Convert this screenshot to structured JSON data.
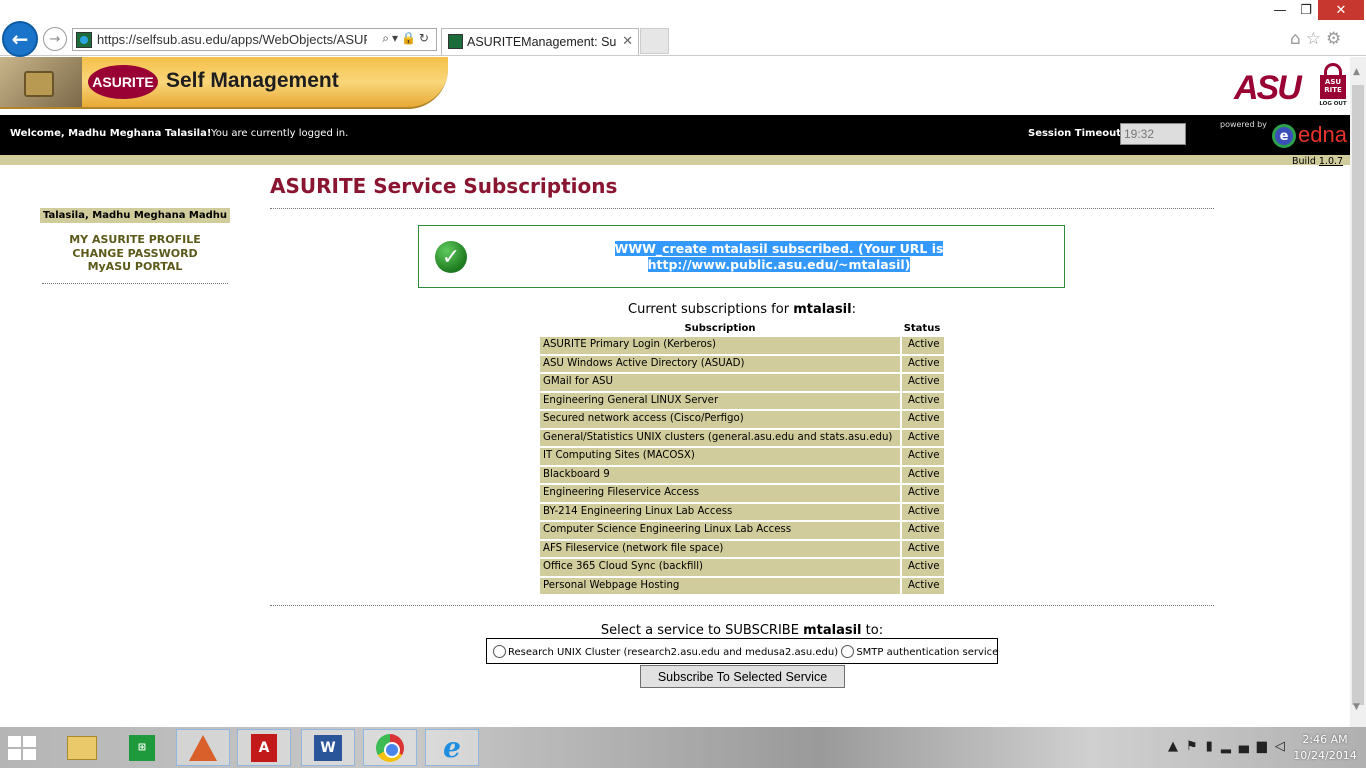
{
  "browser": {
    "url": "https://selfsub.asu.edu/apps/WebObjects/ASURITE",
    "tab_title": "ASURITEManagement: Sub...",
    "tab_close": "✕",
    "min_glyph": "—",
    "max_glyph": "❐",
    "close_glyph": "✕"
  },
  "header": {
    "brand_badge": "ASURITE",
    "brand_title": "Self Management",
    "asu_logo": "ASU",
    "logout_top": "ASU RITE",
    "logout_caption": "LOG OUT"
  },
  "status_bar": {
    "welcome": "Welcome, Madhu Meghana Talasila!",
    "logged_in": "You are currently logged in.",
    "session_label": "Session Timeout:",
    "session_value": "19:32",
    "powered_by": "powered by",
    "edna": "edna",
    "build_label": "Build",
    "build_version": "1.0.7"
  },
  "sidebar": {
    "user_name": "Talasila, Madhu Meghana Madhu",
    "links": [
      {
        "label": "MY ASURITE PROFILE"
      },
      {
        "label": "CHANGE PASSWORD"
      },
      {
        "label": "MyASU PORTAL"
      }
    ]
  },
  "main": {
    "title": "ASURITE Service Subscriptions",
    "message_line1": "WWW_create mtalasil subscribed. (Your URL is",
    "message_line2": "http://www.public.asu.edu/~mtalasil)",
    "subs_prefix": "Current subscriptions for",
    "username": "mtalasil",
    "subs_suffix": ":",
    "table": {
      "headers": [
        "Subscription",
        "Status"
      ],
      "rows": [
        {
          "name": "ASURITE Primary Login (Kerberos)",
          "status": "Active"
        },
        {
          "name": "ASU Windows Active Directory (ASUAD)",
          "status": "Active"
        },
        {
          "name": "GMail for ASU",
          "status": "Active"
        },
        {
          "name": "Engineering General LINUX Server",
          "status": "Active"
        },
        {
          "name": "Secured network access (Cisco/Perfigo)",
          "status": "Active"
        },
        {
          "name": "General/Statistics UNIX clusters (general.asu.edu and stats.asu.edu)",
          "status": "Active"
        },
        {
          "name": "IT Computing Sites (MACOSX)",
          "status": "Active"
        },
        {
          "name": "Blackboard 9",
          "status": "Active"
        },
        {
          "name": "Engineering Fileservice Access",
          "status": "Active"
        },
        {
          "name": "BY-214 Engineering Linux Lab Access",
          "status": "Active"
        },
        {
          "name": "Computer Science Engineering Linux Lab Access",
          "status": "Active"
        },
        {
          "name": "AFS Fileservice (network file space)",
          "status": "Active"
        },
        {
          "name": "Office 365 Cloud Sync (backfill)",
          "status": "Active"
        },
        {
          "name": "Personal Webpage Hosting",
          "status": "Active"
        }
      ]
    },
    "select_prefix": "Select a service to SUBSCRIBE",
    "select_suffix": "to:",
    "options": [
      {
        "label": "Research UNIX Cluster (research2.asu.edu and medusa2.asu.edu)"
      },
      {
        "label": "SMTP authentication service"
      }
    ],
    "subscribe_button": "Subscribe To Selected Service"
  },
  "taskbar": {
    "time": "2:46 AM",
    "date": "10/24/2014",
    "store_label": "⊞",
    "acrobat_label": "A",
    "word_label": "W",
    "ie_label": "e"
  },
  "colors": {
    "asu_maroon": "#8a1531",
    "khaki": "#d0cc9c",
    "success_green": "#2f8a3a",
    "selection_blue": "#3399ff"
  }
}
